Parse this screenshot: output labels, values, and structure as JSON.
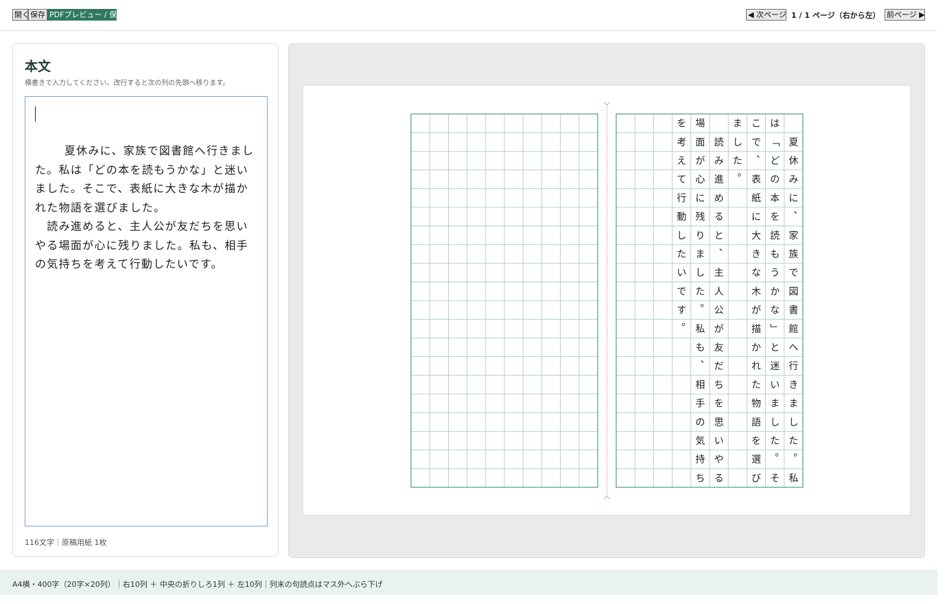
{
  "toolbar": {
    "open_label": "開く",
    "save_label": "保存",
    "pdf_label": "PDFプレビュー / 保存",
    "next_label": "◀ 次ページ",
    "page_indicator": "1 / 1 ページ（右から左）",
    "prev_label": "前ページ ▶"
  },
  "editor": {
    "title": "本文",
    "hint": "横書きで入力してください。改行すると次の列の先頭へ移ります。",
    "text": "　夏休みに、家族で図書館へ行きました。私は「どの本を読もうかな」と迷いました。そこで、表紙に大きな木が描かれた物語を選びました。\n　読み進めると、主人公が友だちを思いやる場面が心に残りました。私も、相手の気持ちを考えて行動したいです。",
    "char_count": "116文字｜原稿用紙 1枚"
  },
  "preview": {
    "columns": [
      "　夏休みに、家族で図書館へ行きました。私",
      "は「どの本を読もうかな」と迷いました。そ",
      "こで、表紙に大きな木が描かれた物語を選び",
      "ました。",
      "　読み進めると、主人公が友だちを思いやる",
      "場面が心に残りました。私も、相手の気持ち",
      "を考えて行動したいです。"
    ],
    "rows_per_column": 20,
    "columns_per_half": 10,
    "grid_color": "#5aa58a",
    "fold_mark_color": "#d9a085"
  },
  "status": {
    "text": "A4横・400字（20字×20列）｜右10列 ＋ 中央の折りしろ1列 ＋ 左10列｜列末の句読点はマス外へぶら下げ"
  },
  "colors": {
    "accent": "#2f7a5f",
    "status_bg": "#e9f2ee",
    "preview_bg": "#e9ebea"
  }
}
